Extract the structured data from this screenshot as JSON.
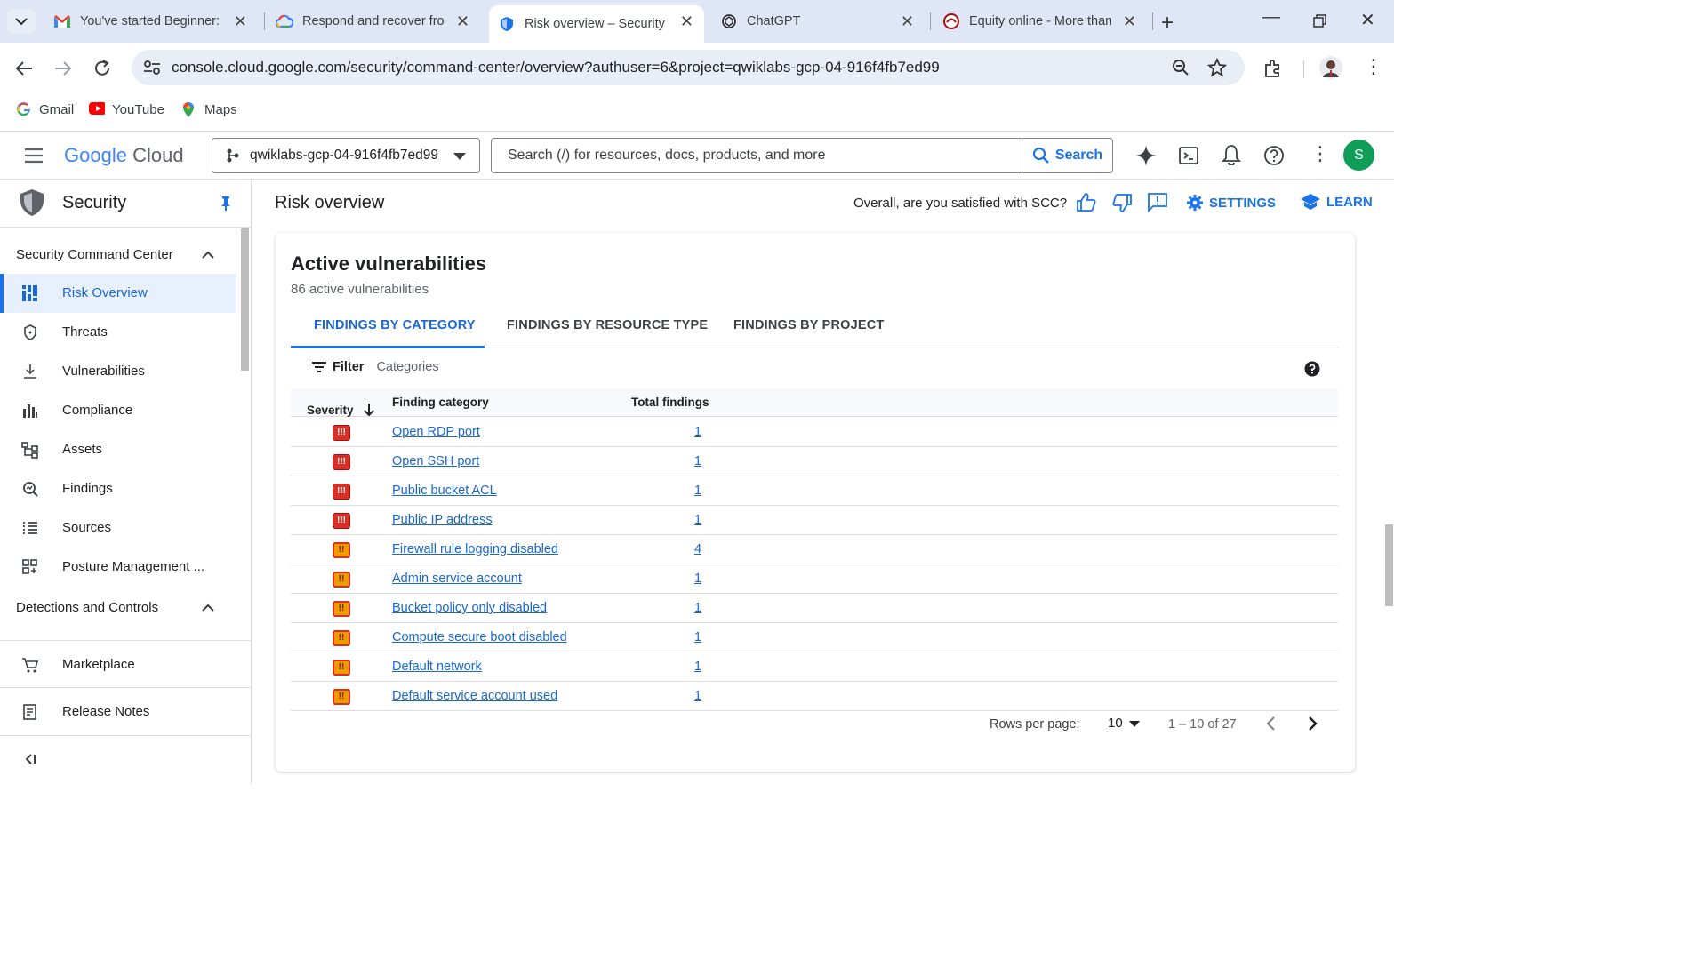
{
  "browser": {
    "tabs": [
      {
        "title": "You've started Beginner: C",
        "icon": "gmail-icon"
      },
      {
        "title": "Respond and recover from",
        "icon": "google-cloud-icon"
      },
      {
        "title": "Risk overview – Security –",
        "icon": "security-shield-icon",
        "active": true
      },
      {
        "title": "ChatGPT",
        "icon": "chatgpt-icon"
      },
      {
        "title": "Equity online - More than",
        "icon": "equity-icon"
      }
    ],
    "url": "console.cloud.google.com/security/command-center/overview?authuser=6&project=qwiklabs-gcp-04-916f4fb7ed99",
    "bookmarks": [
      "Gmail",
      "YouTube",
      "Maps"
    ]
  },
  "gcp_header": {
    "logo_google": "Google",
    "logo_cloud": "Cloud",
    "project": "qwiklabs-gcp-04-916f4fb7ed99",
    "search_placeholder": "Search (/) for resources, docs, products, and more",
    "search_button": "Search",
    "avatar_letter": "S"
  },
  "sidebar": {
    "product_title": "Security",
    "section1": "Security Command Center",
    "items": [
      {
        "label": "Risk Overview",
        "icon": "dashboard-icon",
        "active": true
      },
      {
        "label": "Threats",
        "icon": "shield-icon"
      },
      {
        "label": "Vulnerabilities",
        "icon": "download-icon"
      },
      {
        "label": "Compliance",
        "icon": "bar-chart-icon"
      },
      {
        "label": "Assets",
        "icon": "hierarchy-icon"
      },
      {
        "label": "Findings",
        "icon": "search-document-icon"
      },
      {
        "label": "Sources",
        "icon": "list-icon"
      },
      {
        "label": "Posture Management ...",
        "icon": "grid-icon"
      }
    ],
    "section2": "Detections and Controls",
    "marketplace": "Marketplace",
    "release_notes": "Release Notes"
  },
  "page": {
    "title": "Risk overview",
    "satisfaction": "Overall, are you satisfied with SCC?",
    "settings": "SETTINGS",
    "learn": "LEARN"
  },
  "card": {
    "title": "Active vulnerabilities",
    "subtitle": "86 active vulnerabilities",
    "tabs": [
      "FINDINGS BY CATEGORY",
      "FINDINGS BY RESOURCE TYPE",
      "FINDINGS BY PROJECT"
    ],
    "filter_label": "Filter",
    "filter_placeholder": "Categories",
    "columns": [
      "Severity",
      "Finding category",
      "Total findings"
    ],
    "rows": [
      {
        "severity": "critical",
        "category": "Open RDP port",
        "total": "1"
      },
      {
        "severity": "critical",
        "category": "Open SSH port",
        "total": "1"
      },
      {
        "severity": "critical",
        "category": "Public bucket ACL",
        "total": "1"
      },
      {
        "severity": "critical",
        "category": "Public IP address",
        "total": "1"
      },
      {
        "severity": "high",
        "category": "Firewall rule logging disabled",
        "total": "4"
      },
      {
        "severity": "high",
        "category": "Admin service account",
        "total": "1"
      },
      {
        "severity": "high",
        "category": "Bucket policy only disabled",
        "total": "1"
      },
      {
        "severity": "high",
        "category": "Compute secure boot disabled",
        "total": "1"
      },
      {
        "severity": "high",
        "category": "Default network",
        "total": "1"
      },
      {
        "severity": "high",
        "category": "Default service account used",
        "total": "1"
      }
    ],
    "rows_per_page_label": "Rows per page:",
    "rows_per_page": "10",
    "range": "1 – 10 of 27"
  },
  "colors": {
    "accent": "#1a73e8",
    "critical": "#d93025",
    "high": "#f29900"
  }
}
